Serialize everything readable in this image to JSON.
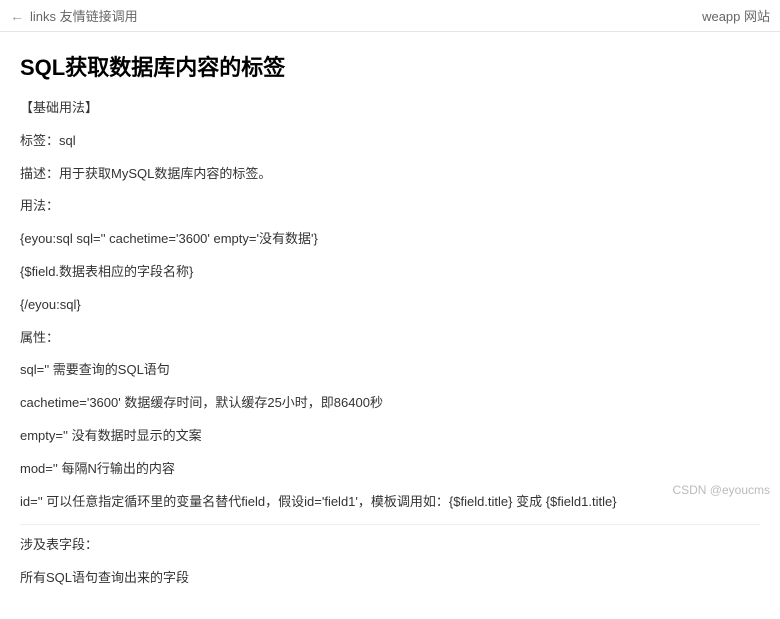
{
  "nav": {
    "prev_link": "links 友情链接调用",
    "next_link": "weapp 网站"
  },
  "title": "SQL获取数据库内容的标签",
  "sections": {
    "basic_header": "【基础用法】",
    "tag_label": "标签：sql",
    "desc": "描述：用于获取MySQL数据库内容的标签。",
    "usage_label": "用法：",
    "usage_line1": "{eyou:sql sql='' cachetime='3600' empty='没有数据'}",
    "usage_line2": "{$field.数据表相应的字段名称}",
    "usage_line3": "{/eyou:sql}",
    "attr_label": "属性：",
    "attr_sql": "sql='' 需要查询的SQL语句",
    "attr_cachetime": "cachetime='3600' 数据缓存时间，默认缓存25小时，即86400秒",
    "attr_empty": "empty='' 没有数据时显示的文案",
    "attr_mod": "mod='' 每隔N行输出的内容",
    "attr_id": "id='' 可以任意指定循环里的变量名替代field，假设id='field1'，模板调用如：{$field.title} 变成 {$field1.title}",
    "fields_label": "涉及表字段：",
    "fields_desc": "所有SQL语句查询出来的字段"
  },
  "watermark": "CSDN @eyoucms"
}
